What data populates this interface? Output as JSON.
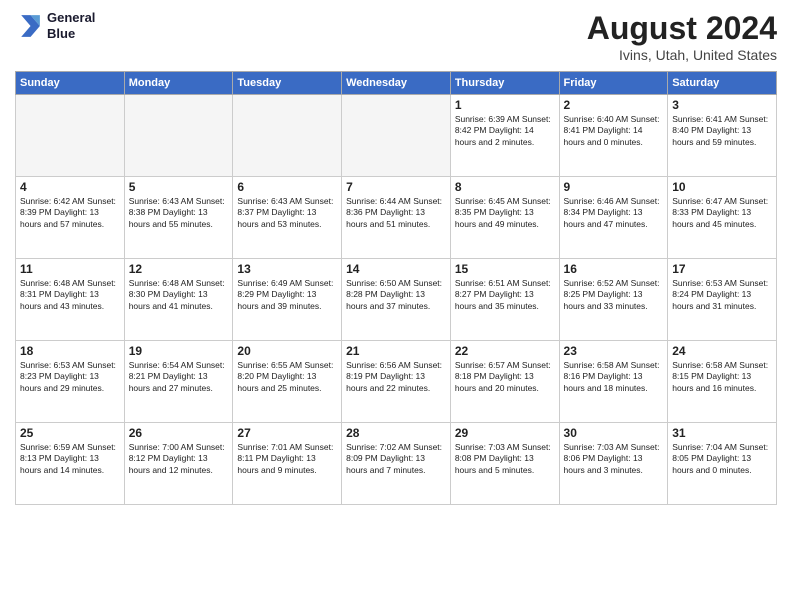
{
  "logo": {
    "line1": "General",
    "line2": "Blue"
  },
  "title": "August 2024",
  "subtitle": "Ivins, Utah, United States",
  "days_of_week": [
    "Sunday",
    "Monday",
    "Tuesday",
    "Wednesday",
    "Thursday",
    "Friday",
    "Saturday"
  ],
  "weeks": [
    [
      {
        "day": "",
        "info": ""
      },
      {
        "day": "",
        "info": ""
      },
      {
        "day": "",
        "info": ""
      },
      {
        "day": "",
        "info": ""
      },
      {
        "day": "1",
        "info": "Sunrise: 6:39 AM\nSunset: 8:42 PM\nDaylight: 14 hours\nand 2 minutes."
      },
      {
        "day": "2",
        "info": "Sunrise: 6:40 AM\nSunset: 8:41 PM\nDaylight: 14 hours\nand 0 minutes."
      },
      {
        "day": "3",
        "info": "Sunrise: 6:41 AM\nSunset: 8:40 PM\nDaylight: 13 hours\nand 59 minutes."
      }
    ],
    [
      {
        "day": "4",
        "info": "Sunrise: 6:42 AM\nSunset: 8:39 PM\nDaylight: 13 hours\nand 57 minutes."
      },
      {
        "day": "5",
        "info": "Sunrise: 6:43 AM\nSunset: 8:38 PM\nDaylight: 13 hours\nand 55 minutes."
      },
      {
        "day": "6",
        "info": "Sunrise: 6:43 AM\nSunset: 8:37 PM\nDaylight: 13 hours\nand 53 minutes."
      },
      {
        "day": "7",
        "info": "Sunrise: 6:44 AM\nSunset: 8:36 PM\nDaylight: 13 hours\nand 51 minutes."
      },
      {
        "day": "8",
        "info": "Sunrise: 6:45 AM\nSunset: 8:35 PM\nDaylight: 13 hours\nand 49 minutes."
      },
      {
        "day": "9",
        "info": "Sunrise: 6:46 AM\nSunset: 8:34 PM\nDaylight: 13 hours\nand 47 minutes."
      },
      {
        "day": "10",
        "info": "Sunrise: 6:47 AM\nSunset: 8:33 PM\nDaylight: 13 hours\nand 45 minutes."
      }
    ],
    [
      {
        "day": "11",
        "info": "Sunrise: 6:48 AM\nSunset: 8:31 PM\nDaylight: 13 hours\nand 43 minutes."
      },
      {
        "day": "12",
        "info": "Sunrise: 6:48 AM\nSunset: 8:30 PM\nDaylight: 13 hours\nand 41 minutes."
      },
      {
        "day": "13",
        "info": "Sunrise: 6:49 AM\nSunset: 8:29 PM\nDaylight: 13 hours\nand 39 minutes."
      },
      {
        "day": "14",
        "info": "Sunrise: 6:50 AM\nSunset: 8:28 PM\nDaylight: 13 hours\nand 37 minutes."
      },
      {
        "day": "15",
        "info": "Sunrise: 6:51 AM\nSunset: 8:27 PM\nDaylight: 13 hours\nand 35 minutes."
      },
      {
        "day": "16",
        "info": "Sunrise: 6:52 AM\nSunset: 8:25 PM\nDaylight: 13 hours\nand 33 minutes."
      },
      {
        "day": "17",
        "info": "Sunrise: 6:53 AM\nSunset: 8:24 PM\nDaylight: 13 hours\nand 31 minutes."
      }
    ],
    [
      {
        "day": "18",
        "info": "Sunrise: 6:53 AM\nSunset: 8:23 PM\nDaylight: 13 hours\nand 29 minutes."
      },
      {
        "day": "19",
        "info": "Sunrise: 6:54 AM\nSunset: 8:21 PM\nDaylight: 13 hours\nand 27 minutes."
      },
      {
        "day": "20",
        "info": "Sunrise: 6:55 AM\nSunset: 8:20 PM\nDaylight: 13 hours\nand 25 minutes."
      },
      {
        "day": "21",
        "info": "Sunrise: 6:56 AM\nSunset: 8:19 PM\nDaylight: 13 hours\nand 22 minutes."
      },
      {
        "day": "22",
        "info": "Sunrise: 6:57 AM\nSunset: 8:18 PM\nDaylight: 13 hours\nand 20 minutes."
      },
      {
        "day": "23",
        "info": "Sunrise: 6:58 AM\nSunset: 8:16 PM\nDaylight: 13 hours\nand 18 minutes."
      },
      {
        "day": "24",
        "info": "Sunrise: 6:58 AM\nSunset: 8:15 PM\nDaylight: 13 hours\nand 16 minutes."
      }
    ],
    [
      {
        "day": "25",
        "info": "Sunrise: 6:59 AM\nSunset: 8:13 PM\nDaylight: 13 hours\nand 14 minutes."
      },
      {
        "day": "26",
        "info": "Sunrise: 7:00 AM\nSunset: 8:12 PM\nDaylight: 13 hours\nand 12 minutes."
      },
      {
        "day": "27",
        "info": "Sunrise: 7:01 AM\nSunset: 8:11 PM\nDaylight: 13 hours\nand 9 minutes."
      },
      {
        "day": "28",
        "info": "Sunrise: 7:02 AM\nSunset: 8:09 PM\nDaylight: 13 hours\nand 7 minutes."
      },
      {
        "day": "29",
        "info": "Sunrise: 7:03 AM\nSunset: 8:08 PM\nDaylight: 13 hours\nand 5 minutes."
      },
      {
        "day": "30",
        "info": "Sunrise: 7:03 AM\nSunset: 8:06 PM\nDaylight: 13 hours\nand 3 minutes."
      },
      {
        "day": "31",
        "info": "Sunrise: 7:04 AM\nSunset: 8:05 PM\nDaylight: 13 hours\nand 0 minutes."
      }
    ]
  ]
}
